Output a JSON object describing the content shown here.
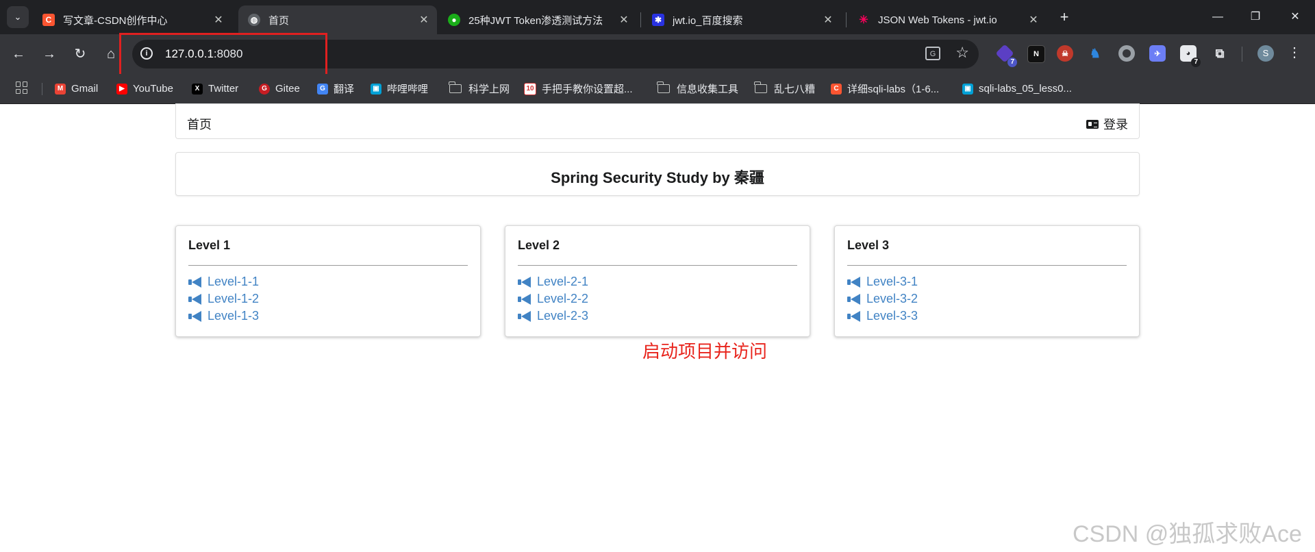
{
  "browser": {
    "tabs": [
      {
        "title": "写文章-CSDN创作中心",
        "icon": "csdn-icon",
        "active": false
      },
      {
        "title": "首页",
        "icon": "globe-icon",
        "active": true
      },
      {
        "title": "25种JWT Token渗透测试方法",
        "icon": "wechat-icon",
        "active": false
      },
      {
        "title": "jwt.io_百度搜索",
        "icon": "baidu-icon",
        "active": false
      },
      {
        "title": "JSON Web Tokens - jwt.io",
        "icon": "jwt-icon",
        "active": false
      }
    ],
    "url_host": "127.0.0.1",
    "url_port": ":8080",
    "extensions": [
      {
        "name": "purple-extension-icon",
        "badge": "7"
      },
      {
        "name": "n-extension-icon",
        "badge": ""
      },
      {
        "name": "pirate-extension-icon",
        "badge": ""
      },
      {
        "name": "wappalyzer-extension-icon",
        "badge": ""
      },
      {
        "name": "circle-extension-icon",
        "badge": ""
      },
      {
        "name": "bird-extension-icon",
        "badge": ""
      },
      {
        "name": "cookie-extension-icon",
        "badge": "7"
      }
    ],
    "profile_initial": "S",
    "bookmarks": [
      {
        "label": "Gmail",
        "icon": "gmail-icon"
      },
      {
        "label": "YouTube",
        "icon": "youtube-icon"
      },
      {
        "label": "Twitter",
        "icon": "x-icon"
      },
      {
        "label": "Gitee",
        "icon": "gitee-icon"
      },
      {
        "label": "翻译",
        "icon": "translate-icon"
      },
      {
        "label": "哔哩哔哩",
        "icon": "bilibili-icon"
      },
      {
        "label": "科学上网",
        "icon": "folder-icon"
      },
      {
        "label": "手把手教你设置超...",
        "icon": "10-icon"
      },
      {
        "label": "信息收集工具",
        "icon": "folder-icon"
      },
      {
        "label": "乱七八糟",
        "icon": "folder-icon"
      },
      {
        "label": "详细sqli-labs（1-6...",
        "icon": "csdn-icon"
      },
      {
        "label": "sqli-labs_05_less0...",
        "icon": "bilibili-icon"
      }
    ]
  },
  "page": {
    "nav_home": "首页",
    "nav_login": "登录",
    "title": "Spring Security Study by 秦疆",
    "levels": [
      {
        "title": "Level 1",
        "links": [
          "Level-1-1",
          "Level-1-2",
          "Level-1-3"
        ]
      },
      {
        "title": "Level 2",
        "links": [
          "Level-2-1",
          "Level-2-2",
          "Level-2-3"
        ]
      },
      {
        "title": "Level 3",
        "links": [
          "Level-3-1",
          "Level-3-2",
          "Level-3-3"
        ]
      }
    ],
    "annotation": "启动项目并访问",
    "watermark": "CSDN @独孤求败Ace"
  },
  "colors": {
    "link": "#4183c4",
    "annotation": "#e8241c",
    "highlight_box": "#e02020"
  }
}
